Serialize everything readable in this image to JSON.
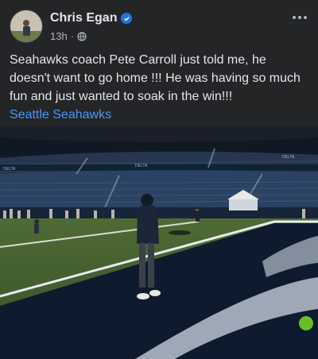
{
  "post": {
    "author": "Chris Egan",
    "timestamp": "13h",
    "audience_icon": "globe-icon",
    "body_text": "Seahawks coach Pete Carroll just told me, he doesn't want to go home !!! He was having so much fun and just wanted to soak in the win!!!",
    "link_text": "Seattle Seahawks",
    "more_icon": "more-options-icon"
  },
  "photo": {
    "banner_left": "DELTA",
    "banner_center": "DELTA",
    "banner_right": "DELTA"
  },
  "colors": {
    "link": "#4599ff",
    "verified": "#2374e1",
    "background": "#242526"
  }
}
